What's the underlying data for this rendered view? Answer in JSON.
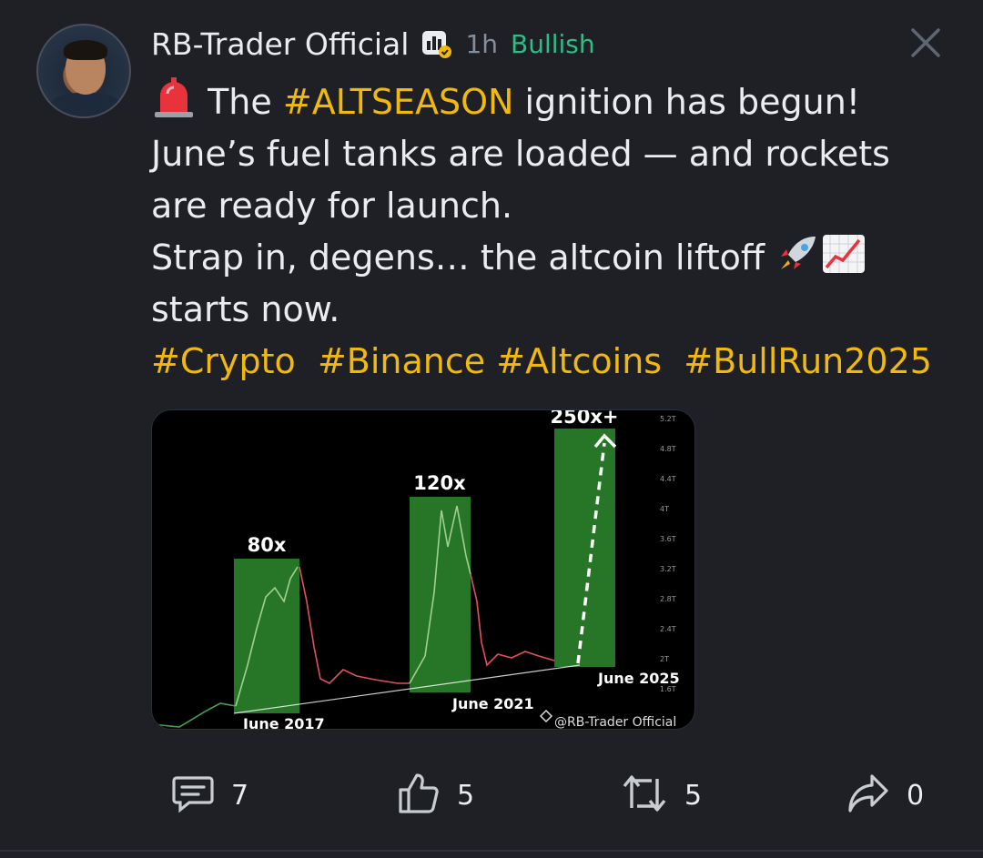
{
  "post": {
    "author": "RB-Trader Official",
    "time": "1h",
    "sentiment": "Bullish",
    "lines": {
      "l1_pre": "The",
      "l1_tag": "#ALTSEASON",
      "l1_post": "ignition has begun!",
      "l2": "June’s fuel tanks are loaded — and rockets",
      "l3": "are ready for launch.",
      "l4": "Strap in, degens… the altcoin liftoff",
      "l5": "starts now."
    },
    "hashtags": [
      "#Crypto",
      "#Binance",
      "#Altcoins",
      "#BullRun2025"
    ],
    "icons": {
      "siren": "police-light-emoji",
      "rocket": "rocket-emoji",
      "chart": "chart-increasing-emoji",
      "badge": "creator-badge-icon",
      "close": "close-icon"
    }
  },
  "chart_data": {
    "type": "line",
    "title": "",
    "annotations": [
      {
        "label": "80x",
        "period": "June 2017"
      },
      {
        "label": "120x",
        "period": "June 2021"
      },
      {
        "label": "250x+",
        "period": "June 2025"
      }
    ],
    "y_tick_labels": [
      "5.2T",
      "4.8T",
      "4.4T",
      "4T",
      "3.6T",
      "3.2T",
      "2.8T",
      "2.4T",
      "2T",
      "1.6T"
    ],
    "watermark": "@RB-Trader Official",
    "colors": {
      "highlight": "#2e8b2e",
      "up": "#3fa34d",
      "down": "#e05060",
      "trend": "#ffffff"
    }
  },
  "actions": {
    "comments": "7",
    "likes": "5",
    "reposts": "5",
    "shares": "0"
  },
  "theme": {
    "background": "#1e2026",
    "accent": "#f0b90b",
    "bullish": "#2ebd85",
    "muted": "#848e9c"
  }
}
